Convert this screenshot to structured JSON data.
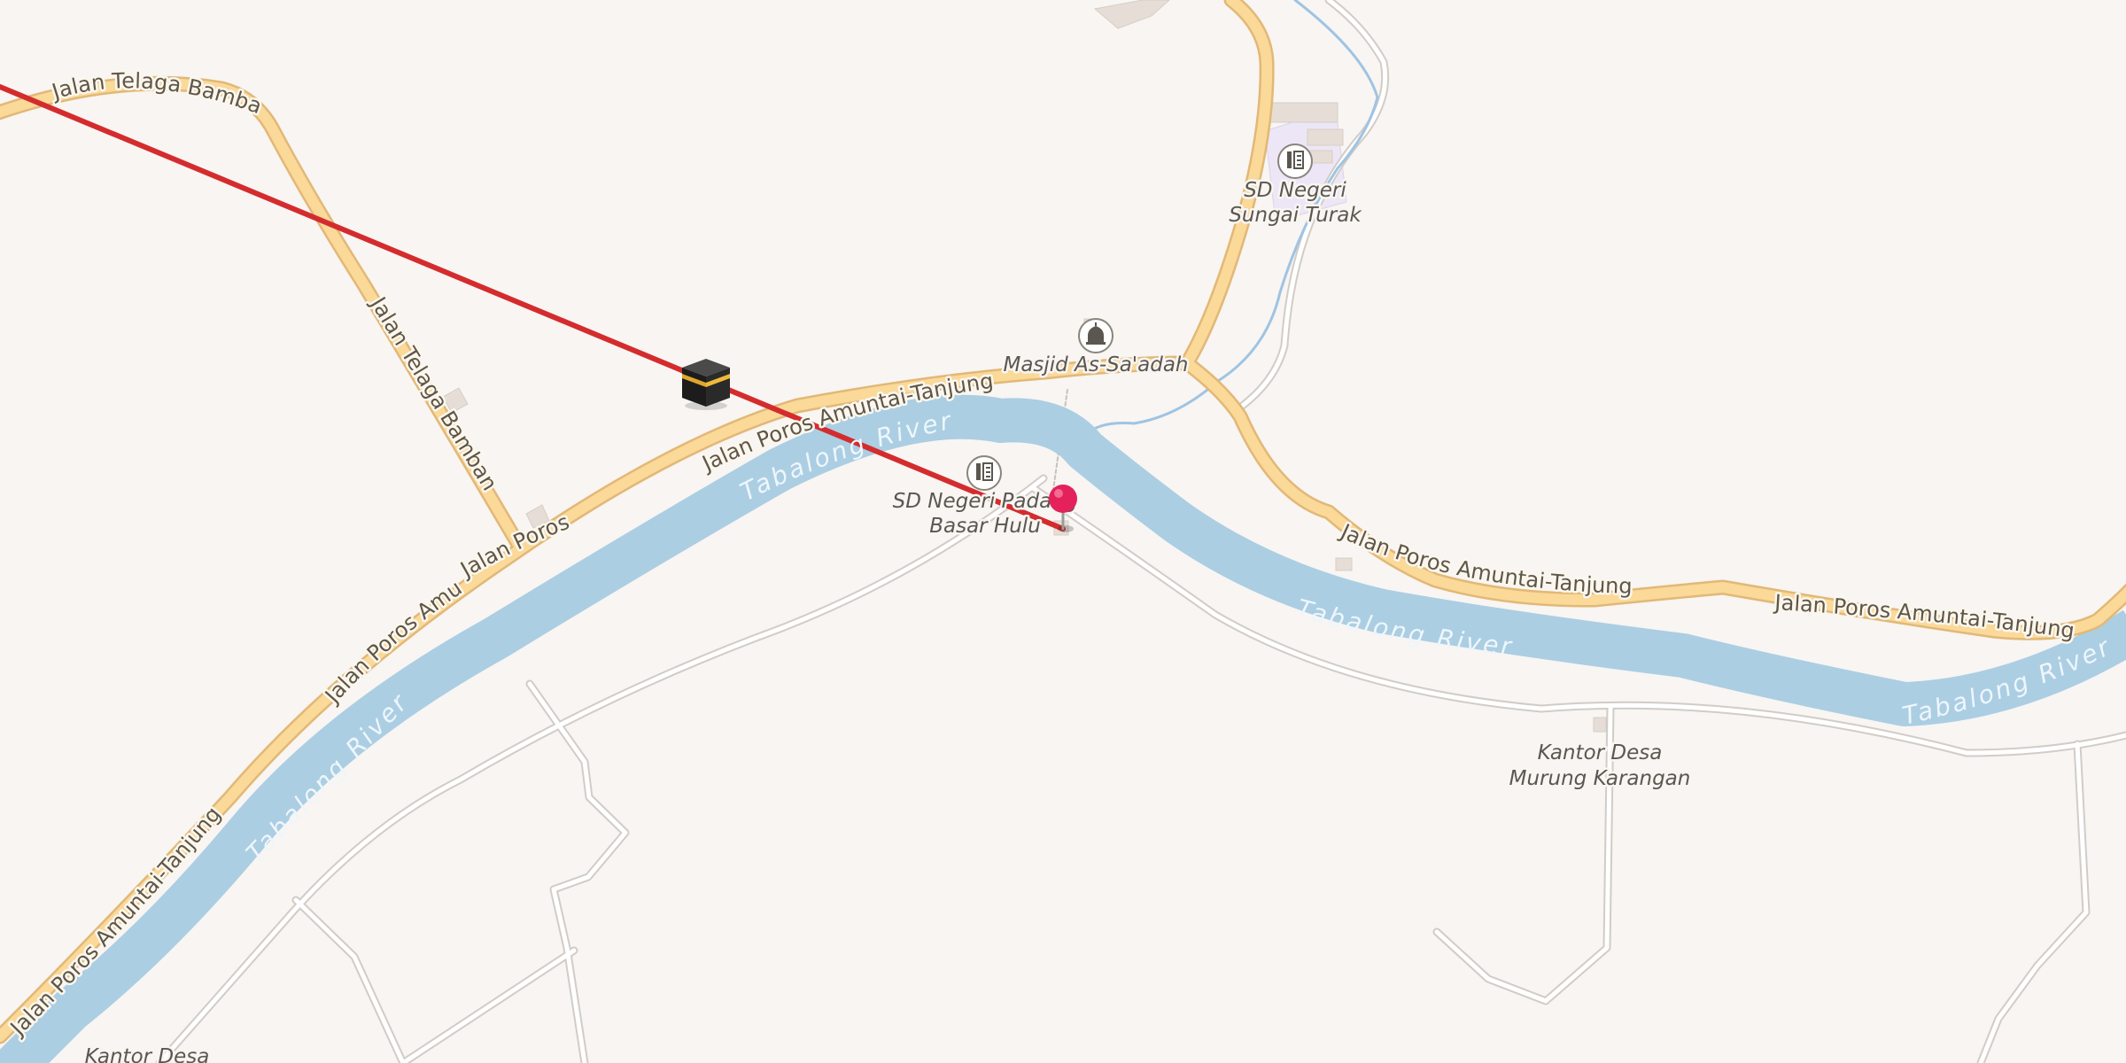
{
  "map": {
    "colors": {
      "background": "#f8f5f2",
      "river": "#abcee3",
      "primary_road": "#fad999",
      "primary_road_casing": "#e2b877",
      "minor_road": "#ffffff",
      "minor_road_casing": "#d2ccc6",
      "stream": "#9fc4e3",
      "qibla_line": "#d42c2e",
      "pin": "#e4215a"
    },
    "road_labels": {
      "telaga_bamban_1": "Jalan Telaga Bamban",
      "telaga_bamban_2": "Jalan Telaga Bamban",
      "amuntai_1": "Jalan Poros Amuntai-Tanjung",
      "amuntai_2": "Jalan Poros Amuntai-Tanjung",
      "amuntai_3": "Jalan Poros Amuntai-Tanjung",
      "amuntai_4": "Jalan Poros Amuntai-Tanjung",
      "amuntai_5": "Jalan Poros Amuntai-Tanjung",
      "amuntai_6": "Jalan Poros Amuntai-Tanjung"
    },
    "river_labels": {
      "tabalong_1": "Tabalong River",
      "tabalong_2": "Tabalong River",
      "tabalong_3": "Tabalong River",
      "tabalong_4": "Tabalong River"
    },
    "pois": {
      "sd_sungai_turak": {
        "line1": "SD Negeri",
        "line2": "Sungai Turak",
        "icon": "school-icon"
      },
      "masjid": {
        "line1": "Masjid As-Sa'adah",
        "icon": "mosque-icon"
      },
      "sd_padang": {
        "line1": "SD Negeri Padang",
        "line2": "Basar Hulu",
        "icon": "school-icon"
      },
      "kantor_murung": {
        "line1": "Kantor Desa",
        "line2": "Murung Karangan"
      },
      "kantor_bottom": {
        "line1": "Kantor Desa"
      }
    },
    "markers": {
      "kaaba": "kaaba-icon",
      "location_pin": "location-pin-icon"
    }
  }
}
